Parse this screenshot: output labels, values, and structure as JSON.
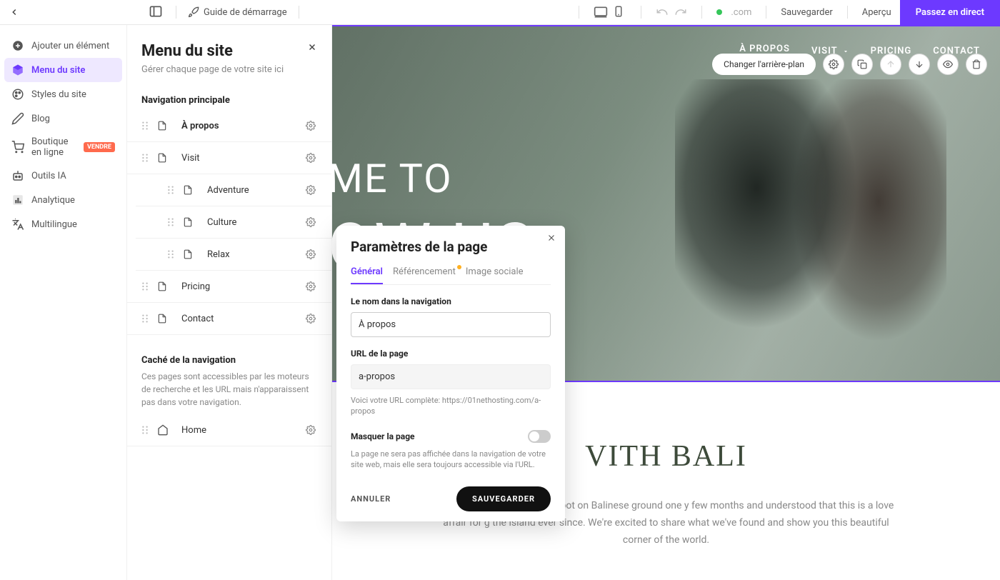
{
  "topbar": {
    "guide": "Guide de démarrage",
    "domain": ".com",
    "save": "Sauvegarder",
    "preview": "Aperçu",
    "golive": "Passez en direct"
  },
  "sidebar": {
    "items": [
      {
        "label": "Ajouter un élément"
      },
      {
        "label": "Menu du site"
      },
      {
        "label": "Styles du site"
      },
      {
        "label": "Blog"
      },
      {
        "label": "Boutique en ligne",
        "pill": "VENDRE"
      },
      {
        "label": "Outils IA"
      },
      {
        "label": "Analytique"
      },
      {
        "label": "Multilingue"
      }
    ]
  },
  "panel": {
    "title": "Menu du site",
    "subtitle": "Gérer chaque page de votre site ici",
    "mainnav_label": "Navigation principale",
    "pages": [
      {
        "label": "À propos",
        "bold": true
      },
      {
        "label": "Visit"
      },
      {
        "label": "Adventure",
        "sub": true
      },
      {
        "label": "Culture",
        "sub": true
      },
      {
        "label": "Relax",
        "sub": true
      },
      {
        "label": "Pricing"
      },
      {
        "label": "Contact"
      }
    ],
    "hidden_label": "Caché de la navigation",
    "hidden_desc": "Ces pages sont accessibles par les moteurs de recherche et les URL mais n'apparaissent pas dans votre navigation.",
    "hidden_pages": [
      {
        "label": "Home"
      }
    ]
  },
  "canvas": {
    "nav": [
      {
        "label": "À PROPOS",
        "active": true
      },
      {
        "label": "VISIT",
        "dropdown": true
      },
      {
        "label": "PRICING"
      },
      {
        "label": "CONTACT"
      }
    ],
    "change_bg": "Changer l'arrière-plan",
    "hero_line1": "ME TO",
    "hero_line2": "OW US",
    "sec2_title": "VITH BALI",
    "sec2_body": "e. The day we stepped our foot on Balinese ground one y few months and understood that this is a love affair for g the island ever since. We're excited to share what we've found and show you this beautiful corner of the world."
  },
  "modal": {
    "title": "Paramètres de la page",
    "tabs": {
      "general": "Général",
      "seo": "Référencement",
      "social": "Image sociale"
    },
    "name_label": "Le nom dans la navigation",
    "name_value": "À propos",
    "url_label": "URL de la page",
    "url_value": "a-propos",
    "url_hint": "Voici votre URL complète: https://01nethosting.com/a-propos",
    "hide_label": "Masquer la page",
    "hide_desc": "La page ne sera pas affichée dans la navigation de votre site web, mais elle sera toujours accessible via l'URL.",
    "cancel": "ANNULER",
    "save": "SAUVEGARDER"
  }
}
